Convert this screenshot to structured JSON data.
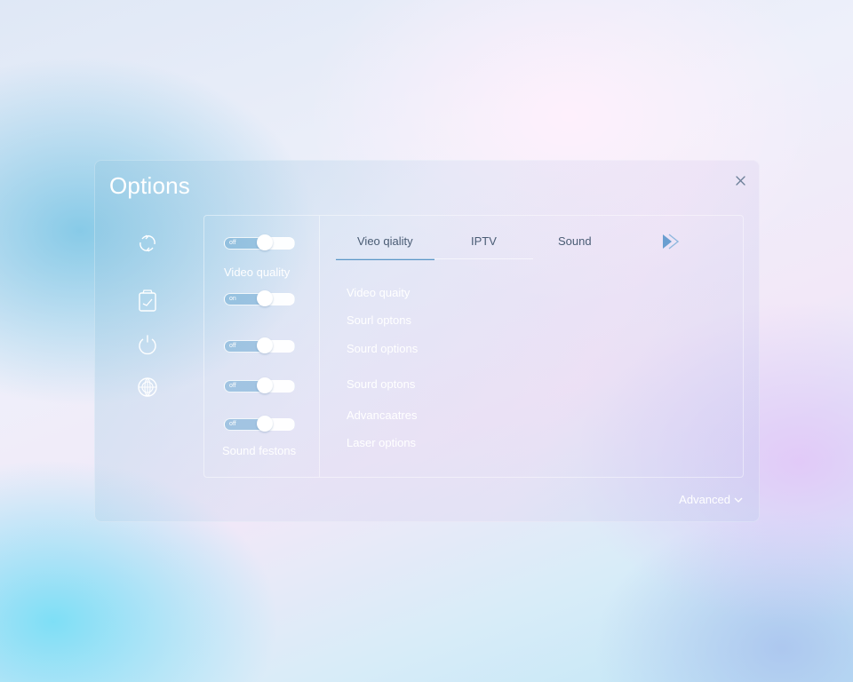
{
  "window": {
    "title": "Options",
    "close_icon": "close-icon"
  },
  "rail": {
    "icons": [
      "sync-icon",
      "document-icon",
      "power-icon",
      "globe-icon"
    ]
  },
  "toggles": [
    {
      "label": "off",
      "value": 0.6
    },
    {
      "label": "on",
      "value": 0.6
    },
    {
      "label": "off",
      "value": 0.6
    },
    {
      "label": "off",
      "value": 0.6
    },
    {
      "label": "off",
      "value": 0.6
    }
  ],
  "column_labels": {
    "top": "Video quality",
    "bottom": "Sound festons"
  },
  "tabs": [
    {
      "label": "Vieo qiality",
      "active": true
    },
    {
      "label": "IPTV",
      "active": false
    },
    {
      "label": "Sound",
      "active": false
    }
  ],
  "tab_next_icon": "play-forward-icon",
  "options": [
    "Video quaity",
    "Sourl optons",
    "Sourd options",
    "Sourd optons",
    "Advancaatres",
    "Laser options"
  ],
  "advanced": {
    "label": "Advanced",
    "icon": "chevron-down-icon"
  },
  "colors": {
    "accent": "#5b95c8",
    "tab_text": "#4a5c74",
    "panel_text": "#ffffff"
  }
}
